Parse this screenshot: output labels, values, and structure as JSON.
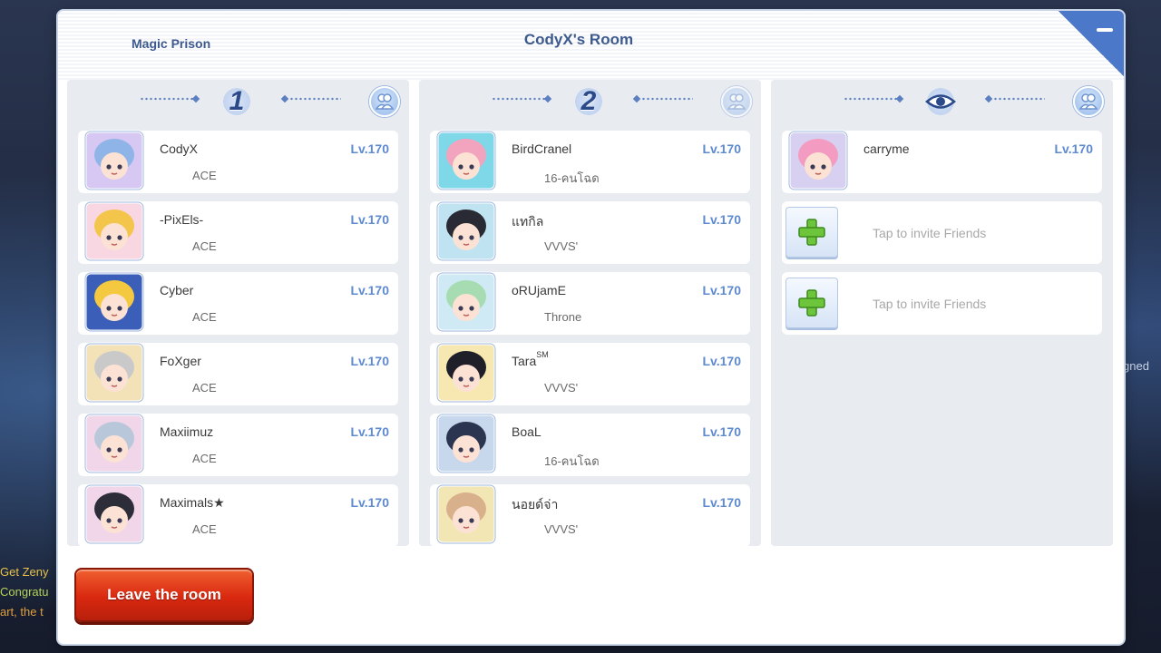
{
  "header": {
    "subtitle": "Magic Prison",
    "title": "CodyX's Room"
  },
  "teams": [
    {
      "number": "1",
      "members": [
        {
          "name": "CodyX",
          "guild": "ACE",
          "level": "Lv.170",
          "avatar": "bunny-ear-avatar"
        },
        {
          "name": "-PixEls-",
          "guild": "ACE",
          "level": "Lv.170",
          "avatar": "duck-hat-avatar"
        },
        {
          "name": "Cyber",
          "guild": "ACE",
          "level": "Lv.170",
          "avatar": "yellow-duck-avatar"
        },
        {
          "name": "FoXger",
          "guild": "ACE",
          "level": "Lv.170",
          "avatar": "grey-hair-glasses-avatar"
        },
        {
          "name": "Maxiimuz",
          "guild": "ACE",
          "level": "Lv.170",
          "avatar": "horned-silver-avatar"
        },
        {
          "name": "Maximals★",
          "guild": "ACE",
          "level": "Lv.170",
          "avatar": "sunglasses-avatar"
        }
      ]
    },
    {
      "number": "2",
      "members": [
        {
          "name": "BirdCranel",
          "guild": "16-คนโฉด",
          "level": "Lv.170",
          "avatar": "pink-cat-avatar"
        },
        {
          "name": "แทกิล",
          "guild": "VVVS'",
          "level": "Lv.170",
          "avatar": "dark-hair-avatar"
        },
        {
          "name": "oRUjamE",
          "guild": "Throne",
          "level": "Lv.170",
          "avatar": "green-hair-avatar"
        },
        {
          "name": "Tara",
          "name_sup": "SM",
          "guild": "VVVS'",
          "level": "Lv.170",
          "avatar": "black-hair-avatar"
        },
        {
          "name": "BoaL",
          "guild": "16-คนโฉด",
          "level": "Lv.170",
          "avatar": "spiky-dark-avatar"
        },
        {
          "name": "นอยด์จ่า",
          "guild": "VVVS'",
          "level": "Lv.170",
          "avatar": "cat-hood-avatar"
        }
      ]
    }
  ],
  "spectators": {
    "members": [
      {
        "name": "carryme",
        "level": "Lv.170",
        "avatar": "pink-twintail-avatar"
      }
    ],
    "invite_text": "Tap to invite Friends"
  },
  "leave_button": "Leave the room",
  "background": {
    "left_lines": [
      "Get Zeny",
      "Congratu",
      "art, the t"
    ],
    "right_text": "gned"
  },
  "colors": {
    "accent": "#3d5a8f",
    "level": "#5e8ad0",
    "leave": "#d92810"
  }
}
